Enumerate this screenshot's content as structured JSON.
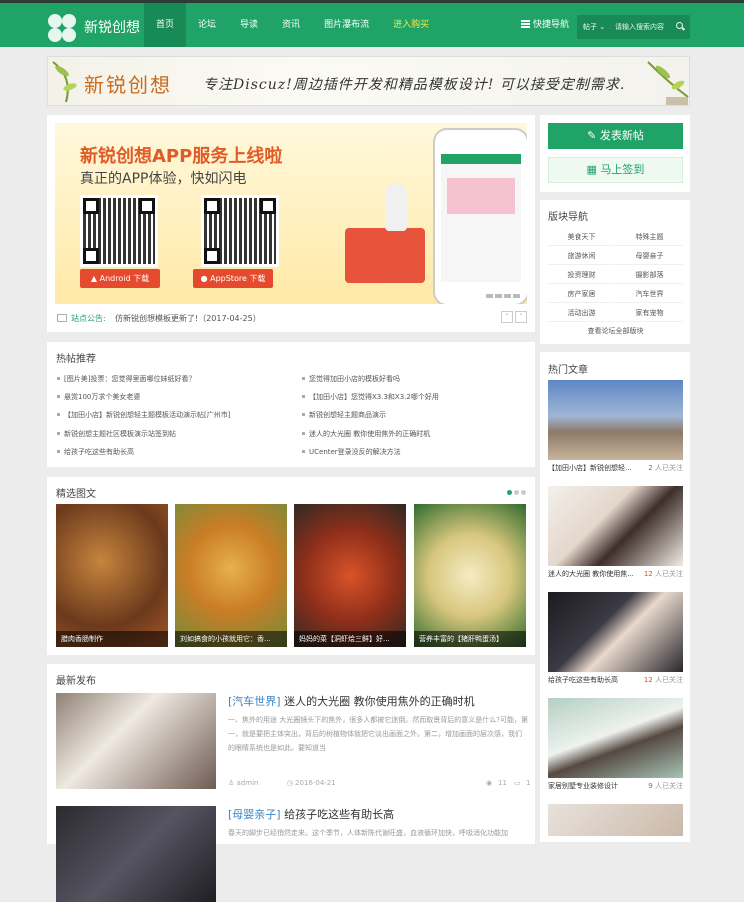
{
  "header": {
    "logo_text": "新锐创想",
    "nav": [
      {
        "label": "首页",
        "active": true
      },
      {
        "label": "论坛"
      },
      {
        "label": "导读"
      },
      {
        "label": "资讯"
      },
      {
        "label": "图片瀑布流"
      },
      {
        "label": "进入购买",
        "highlight": true
      }
    ],
    "quick_nav": "快捷导航",
    "search_type": "帖子",
    "search_placeholder": "请输入搜索内容"
  },
  "banner": {
    "title": "新锐创想",
    "slogan": "专注Discuz!周边插件开发和精品模板设计! 可以接受定制需求."
  },
  "app_promo": {
    "title": "新锐创想APP服务上线啦",
    "subtitle": "真正的APP体验，快如闪电",
    "android": "Android 下载",
    "appstore": "AppStore 下载"
  },
  "notice": {
    "label": "站点公告:",
    "text": "仿新锐创想模板更新了!（2017-04-25）"
  },
  "hot_posts": {
    "title": "热帖推荐",
    "left": [
      "[图片美]投票：您觉得里面哪位妹纸好看？",
      "悬赏100万求个美女老婆",
      "【加田小店】新锐创想轻主题模板活动演示帖[广州市]",
      "新锐创想主题社区模板演示站签到帖",
      "给孩子吃这些有助长高"
    ],
    "right": [
      "您觉得加田小店的模板好看吗",
      "【加田小店】您觉得X3.3和X3.2哪个好用",
      "新锐创想轻主题商品演示",
      "迷人的大光圈 教你使用焦外的正确时机",
      "UCenter登录没反的解决方法"
    ]
  },
  "gallery": {
    "title": "精选图文",
    "items": [
      "腊肉香肠制作",
      "刘如搞食的小孩就用它：香...",
      "妈妈的菜【洞虾烩三鲜】好...",
      "营养丰富的【猪肝鸭蛋汤】"
    ]
  },
  "latest": {
    "title": "最新发布",
    "posts": [
      {
        "category": "[汽车世界]",
        "title": "迷人的大光圈 教你使用焦外的正确时机",
        "desc": "一、焦外的用途 大光圈镜头下的焦外，很多人都被它迷倒。然而取景背后的意义是什么?可能，第一，就是要把主体突出，背后的树植物体就把它淡出画面之外。第二，增加画面的层次感，我们的眼睛系统也是如此。要知道当",
        "author": "admin",
        "date": "2016-04-21",
        "views": "11",
        "replies": "1"
      },
      {
        "category": "[母婴亲子]",
        "title": "给孩子吃这些有助长高",
        "desc": "春天的脚步已经悄然走来。这个季节，人体新陈代谢旺盛，血液循环加快，呼吸消化功能加"
      }
    ]
  },
  "sidebar": {
    "post_button": "发表新帖",
    "sign_button": "马上签到",
    "forum_nav_title": "版块导航",
    "forums": [
      "美食天下",
      "特殊主题",
      "旅游休闲",
      "母婴亲子",
      "投资理财",
      "摄影部落",
      "房产家居",
      "汽车世界",
      "活动出游",
      "家有宠物"
    ],
    "forums_all": "查看论坛全部版块",
    "hot_articles_title": "热门文章",
    "hot_articles": [
      {
        "title": "【加田小店】新锐创想轻...",
        "count": "2",
        "suffix": "人已关注"
      },
      {
        "title": "迷人的大光圈 教你使用焦...",
        "count": "12",
        "suffix": "人已关注"
      },
      {
        "title": "给孩子吃这些有助长高",
        "count": "12",
        "suffix": "人已关注"
      },
      {
        "title": "家居别墅专业装修设计",
        "count": "9",
        "suffix": "人已关注"
      }
    ]
  },
  "colors": {
    "brand": "#1fa367",
    "accent": "#e64a2e",
    "link": "#3b84c5"
  }
}
